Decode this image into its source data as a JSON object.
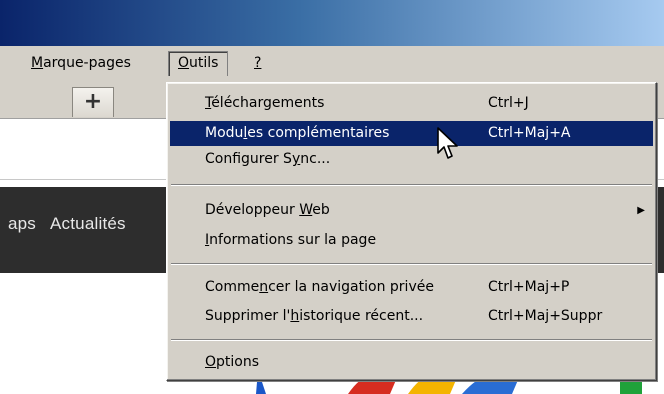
{
  "menubar": {
    "items": [
      {
        "name": "Marque-pages",
        "accel": "M",
        "rest": "arque-pages"
      },
      {
        "name": "Outils",
        "accel": "O",
        "rest": "utils"
      },
      {
        "name": "?",
        "accel": "?",
        "rest": ""
      }
    ]
  },
  "tabs": {
    "new_tab_label": "+"
  },
  "page": {
    "links": [
      "aps",
      "Actualités"
    ]
  },
  "dropdown": {
    "items": [
      {
        "pre": "",
        "accel": "T",
        "post": "éléchargements",
        "shortcut": "Ctrl+J"
      },
      {
        "pre": "Modu",
        "accel": "l",
        "post": "es complémentaires",
        "shortcut": "Ctrl+Maj+A"
      },
      {
        "pre": "Configurer S",
        "accel": "y",
        "post": "nc...",
        "shortcut": ""
      },
      {
        "pre": "Développeur ",
        "accel": "W",
        "post": "eb",
        "shortcut": "▶"
      },
      {
        "pre": "",
        "accel": "I",
        "post": "nformations sur la page",
        "shortcut": ""
      },
      {
        "pre": "Comme",
        "accel": "n",
        "post": "cer la navigation privée",
        "shortcut": "Ctrl+Maj+P"
      },
      {
        "pre": "Supprimer l'",
        "accel": "h",
        "post": "istorique récent...",
        "shortcut": "Ctrl+Maj+Suppr"
      },
      {
        "pre": "",
        "accel": "O",
        "post": "ptions",
        "shortcut": ""
      }
    ]
  },
  "icons": {
    "cursor": "mouse-pointer-icon",
    "submenu": "submenu-arrow-icon"
  },
  "colors": {
    "highlight": "#0a246a",
    "menu_bg": "#d4d0c8",
    "title_start": "#0a246a",
    "title_end": "#a6caf0"
  }
}
